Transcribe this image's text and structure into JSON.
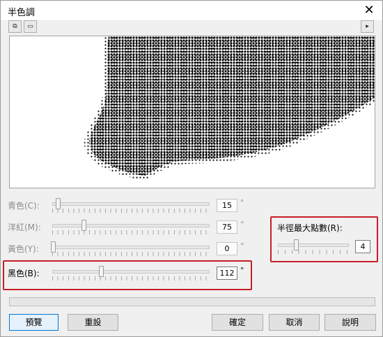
{
  "window": {
    "title": "半色調",
    "close_glyph": "✕"
  },
  "toolbar": {
    "icon_a": "⧉",
    "icon_b": "▭",
    "expand_glyph": "▸"
  },
  "sliders": [
    {
      "label": "青色(C):",
      "value": "15",
      "fraction": 0.03,
      "unit": "°",
      "enabled": false
    },
    {
      "label": "洋紅(M):",
      "value": "75",
      "fraction": 0.2,
      "unit": "°",
      "enabled": false
    },
    {
      "label": "黃色(Y):",
      "value": "0",
      "fraction": 0.0,
      "unit": "°",
      "enabled": false
    },
    {
      "label": "黑色(B):",
      "value": "112",
      "fraction": 0.31,
      "unit": "°",
      "enabled": true
    }
  ],
  "radius": {
    "label": "半徑最大點數(R):",
    "value": "4",
    "fraction": 0.23
  },
  "buttons": {
    "preview": "預覽",
    "reset": "重設",
    "ok": "確定",
    "cancel": "取消",
    "help": "說明"
  },
  "colors": {
    "highlight": "#c61e26",
    "focus_border": "#0078d7"
  }
}
